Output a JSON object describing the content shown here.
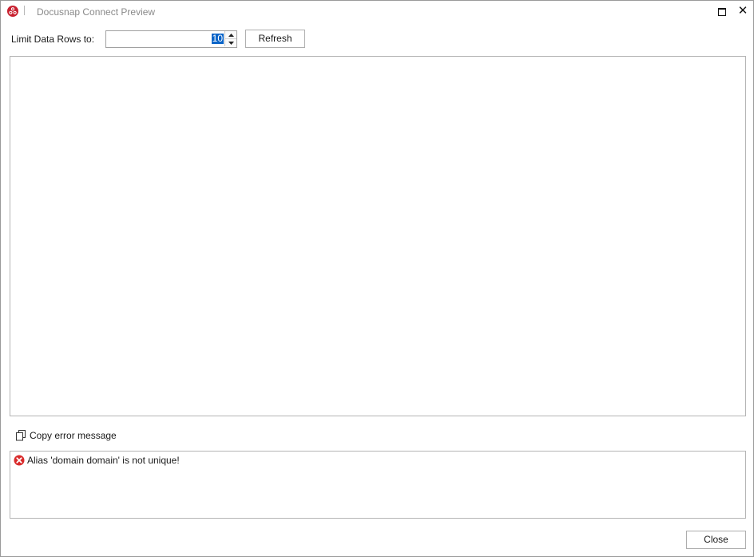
{
  "window": {
    "title": "Docusnap Connect Preview"
  },
  "toolbar": {
    "limit_label": "Limit Data Rows to:",
    "limit_value": "10",
    "refresh_label": "Refresh"
  },
  "error_panel": {
    "copy_label": "Copy error message",
    "message": "Alias 'domain domain' is not unique!"
  },
  "footer": {
    "close_label": "Close"
  },
  "icons": {
    "app": "docusnap-logo-icon",
    "maximize": "maximize-icon",
    "close": "close-icon",
    "copy": "copy-icon",
    "error": "error-icon"
  },
  "colors": {
    "accent": "#0a64c8",
    "error": "#d92b2b",
    "logo": "#c8202f"
  }
}
